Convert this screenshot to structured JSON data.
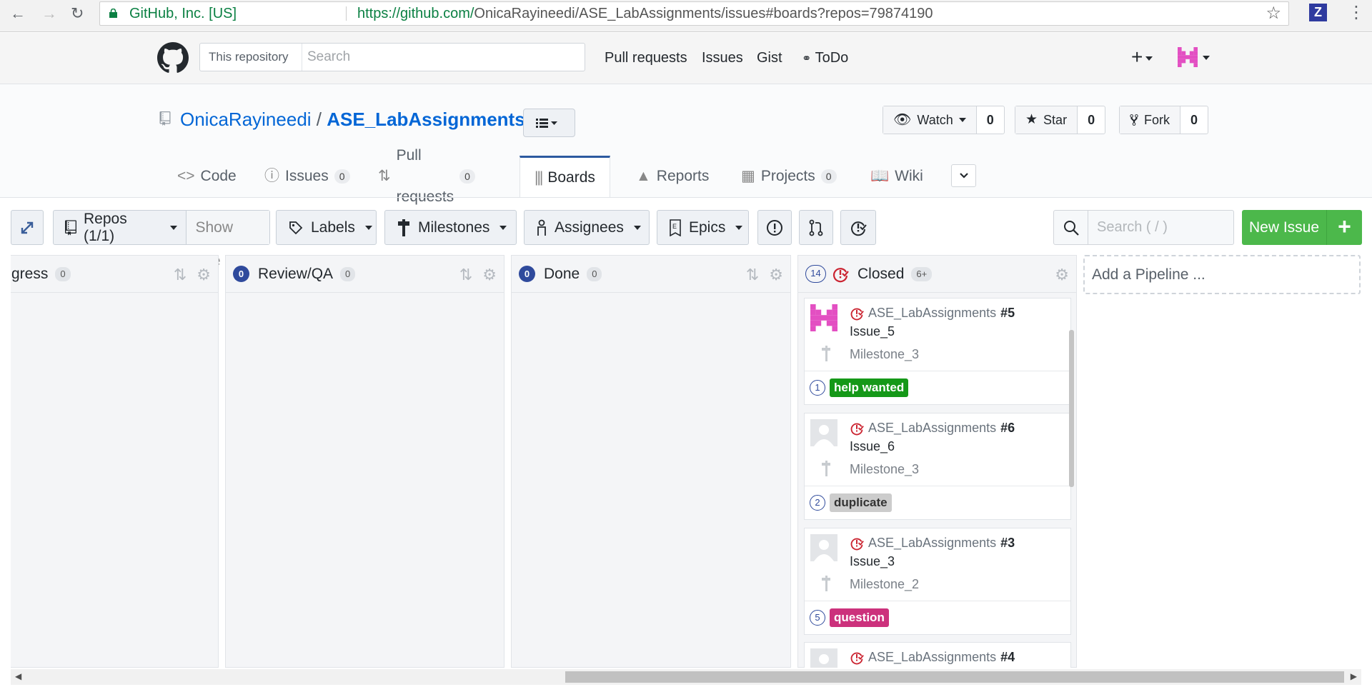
{
  "browser": {
    "security_label": "GitHub, Inc. [US]",
    "url_host": "https://github.com/",
    "url_path": "OnicaRayineedi/ASE_LabAssignments/issues#boards?repos=79874190",
    "ext_label": "Z"
  },
  "header": {
    "search_scope": "This repository",
    "search_placeholder": "Search",
    "nav": [
      "Pull requests",
      "Issues",
      "Gist",
      "ToDo"
    ]
  },
  "repo": {
    "owner": "OnicaRayineedi",
    "separator": "/",
    "name": "ASE_LabAssignments",
    "watch_label": "Watch",
    "watch_count": "0",
    "star_label": "Star",
    "star_count": "0",
    "fork_label": "Fork",
    "fork_count": "0"
  },
  "tabs": [
    {
      "label": "Code",
      "count": null
    },
    {
      "label": "Issues",
      "count": "0"
    },
    {
      "label": "Pull requests",
      "count": "0"
    },
    {
      "label": "Boards",
      "count": null
    },
    {
      "label": "Reports",
      "count": null
    },
    {
      "label": "Projects",
      "count": "0"
    },
    {
      "label": "Wiki",
      "count": null
    }
  ],
  "toolbar": {
    "repos_label": "Repos (1/1)",
    "show_one": "Show one",
    "labels": "Labels",
    "milestones": "Milestones",
    "assignees": "Assignees",
    "epics": "Epics",
    "search_placeholder": "Search ( / )",
    "new_issue": "New Issue",
    "new_issue_plus": "+"
  },
  "pipelines": [
    {
      "name": "gress",
      "count": "0"
    },
    {
      "name": "Review/QA",
      "count": "0",
      "badge": "0"
    },
    {
      "name": "Done",
      "count": "0",
      "badge": "0"
    },
    {
      "name": "Closed",
      "count": "6+",
      "badge": "14"
    }
  ],
  "cards": [
    {
      "repo": "ASE_LabAssignments",
      "number": "#5",
      "title": "Issue_5",
      "milestone": "Milestone_3",
      "estimate": "1",
      "label": "help wanted",
      "label_color": "#159818",
      "label_text_color": "#ffffff"
    },
    {
      "repo": "ASE_LabAssignments",
      "number": "#6",
      "title": "Issue_6",
      "milestone": "Milestone_3",
      "estimate": "2",
      "label": "duplicate",
      "label_color": "#cccccc",
      "label_text_color": "#333333"
    },
    {
      "repo": "ASE_LabAssignments",
      "number": "#3",
      "title": "Issue_3",
      "milestone": "Milestone_2",
      "estimate": "5",
      "label": "question",
      "label_color": "#cc317c",
      "label_text_color": "#ffffff"
    },
    {
      "repo": "ASE_LabAssignments",
      "number": "#4"
    }
  ],
  "add_pipeline": "Add a Pipeline ..."
}
